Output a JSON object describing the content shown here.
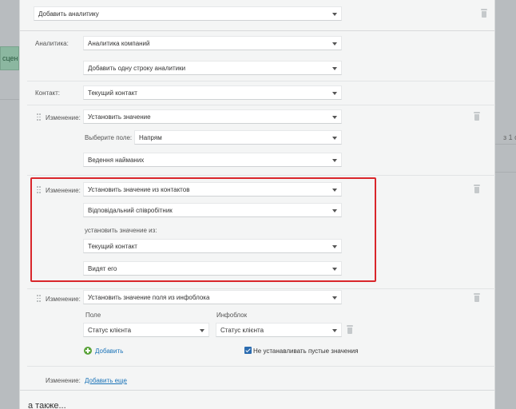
{
  "background": {
    "left_tab_text": "сцен",
    "right_text": "з 1 с"
  },
  "top_row": {
    "select": "Добавить аналитику"
  },
  "analytics": {
    "label": "Аналитика:",
    "select": "Аналитика компаний",
    "add_row_select": "Добавить одну строку аналитики"
  },
  "contact": {
    "label": "Контакт:",
    "select": "Текущий контакт"
  },
  "change1": {
    "label": "Изменение:",
    "action": "Установить значение",
    "field_label": "Выберите поле:",
    "field": "Напрям",
    "value": "Ведення найманих"
  },
  "change2": {
    "label": "Изменение:",
    "action": "Установить значение из контактов",
    "field": "Відповідальний співробітник",
    "from_label": "установить значение из:",
    "from": "Текущий контакт",
    "sub": "Видят его"
  },
  "change3": {
    "label": "Изменение:",
    "action": "Установить значение поля из инфоблока",
    "col_field": "Поле",
    "col_iblock": "Инфоблок",
    "field_value": "Статус клієнта",
    "iblock_value": "Статус клієнта",
    "add_label": "Добавить",
    "checkbox_label": "Не устанавливать пустые значения"
  },
  "more": {
    "label": "Изменение:",
    "link": "Добавить еще"
  },
  "footer": {
    "also": "а также..."
  },
  "colors": {
    "highlight": "#d9262b",
    "link": "#1a73b8",
    "add_icon": "#5aa33a",
    "checkbox": "#2b6cb0"
  }
}
